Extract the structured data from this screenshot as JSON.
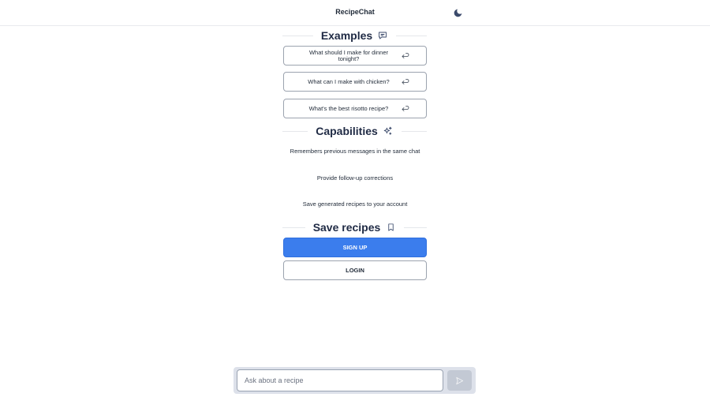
{
  "header": {
    "title": "RecipeChat",
    "theme_icon": "moon-icon"
  },
  "examples": {
    "title": "Examples",
    "icon": "chat-bubble-icon",
    "items": [
      {
        "label": "What should I make for dinner tonight?",
        "icon": "return-arrow-icon"
      },
      {
        "label": "What can I make with chicken?",
        "icon": "return-arrow-icon"
      },
      {
        "label": "What's the best risotto recipe?",
        "icon": "return-arrow-icon"
      }
    ]
  },
  "capabilities": {
    "title": "Capabilities",
    "icon": "sparkles-icon",
    "items": [
      "Remembers previous messages in the same chat",
      "Provide follow-up corrections",
      "Save generated recipes to your account"
    ]
  },
  "save": {
    "title": "Save recipes",
    "icon": "bookmark-icon",
    "signup_label": "SIGN UP",
    "login_label": "LOGIN"
  },
  "composer": {
    "placeholder": "Ask about a recipe",
    "value": "",
    "send_icon": "send-icon"
  },
  "colors": {
    "accent": "#3b7ded",
    "heading": "#1f2a44",
    "send_disabled": "#c3c9d4",
    "composer_bg": "#dde1ea"
  }
}
